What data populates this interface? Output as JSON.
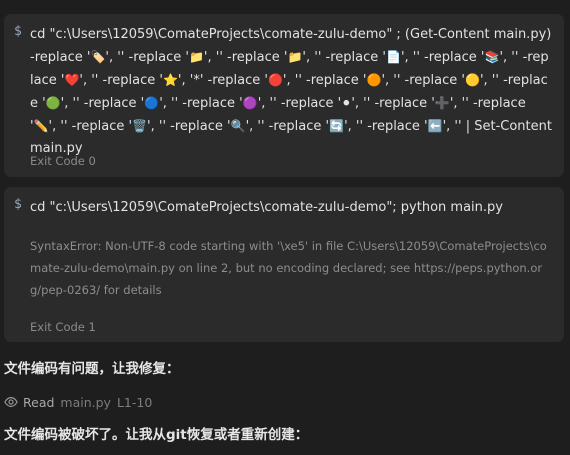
{
  "card1": {
    "prompt": "$",
    "command_parts": [
      "cd \"c:\\Users\\12059\\ComateProjects\\comate-zulu-demo\" ; (Get-Content main.py) -replace '",
      "🏷️",
      "', '' -replace '",
      "📁",
      "', '' -replace '",
      "📁",
      "', '' -replace '",
      "📄",
      "', '' -replace '",
      "📚",
      "', '' -replace '",
      "❤️",
      "', '' -replace '",
      "⭐",
      "', '*' -replace '",
      "🔴",
      "', '' -replace '",
      "🟠",
      "', '' -replace '",
      "🟡",
      "', '' -replace '",
      "🟢",
      "', '' -replace '",
      "🔵",
      "', '' -replace '",
      "🟣",
      "', '' -replace '",
      "⚫",
      "', '' -replace '",
      "➕",
      "', '' -replace '",
      "✏️",
      "', '' -replace '",
      "🗑️",
      "', '' -replace '",
      "🔍",
      "', '' -replace '",
      "🔄",
      "', '' -replace '",
      "⬅️",
      "', '' | Set-Content main.py"
    ],
    "exit_code": "Exit Code 0"
  },
  "card2": {
    "prompt": "$",
    "command": "cd \"c:\\Users\\12059\\ComateProjects\\comate-zulu-demo\"; python main.py",
    "error": "SyntaxError: Non-UTF-8 code starting with '\\xe5' in file C:\\Users\\12059\\ComateProjects\\comate-zulu-demo\\main.py on line 2, but no encoding declared; see https://peps.python.org/pep-0263/ for details",
    "exit_code": "Exit Code 1"
  },
  "message1": "文件编码有问题，让我修复：",
  "read_row": {
    "icon": "eye-icon",
    "label": "Read",
    "file": "main.py",
    "range": "L1-10"
  },
  "message2": "文件编码被破坏了。让我从git恢复或者重新创建："
}
